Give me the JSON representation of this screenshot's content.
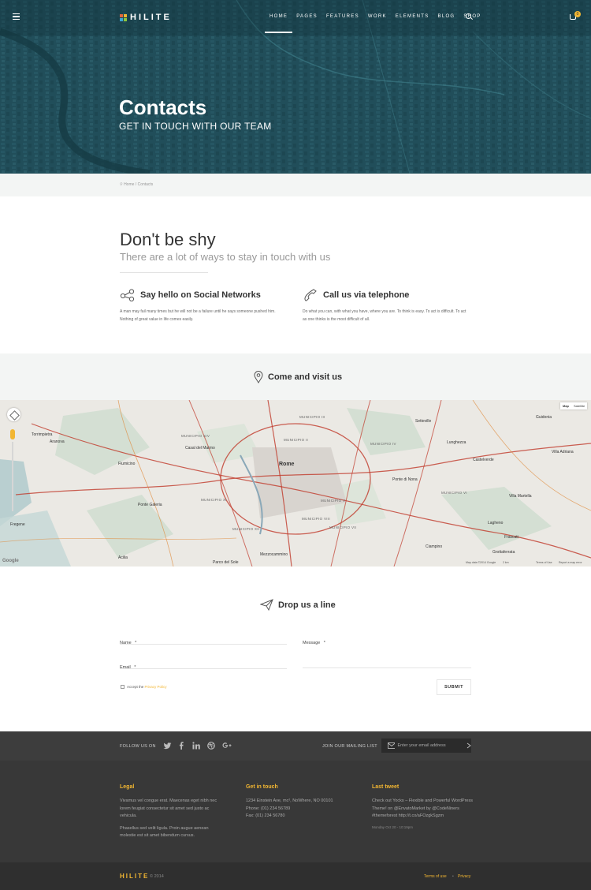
{
  "nav": {
    "logo": "HILITE",
    "items": [
      {
        "label": "Home"
      },
      {
        "label": "Pages"
      },
      {
        "label": "Features"
      },
      {
        "label": "Work"
      },
      {
        "label": "Elements"
      },
      {
        "label": "Blog"
      },
      {
        "label": "Shop"
      }
    ],
    "cart_count": "0"
  },
  "hero": {
    "title": "Contacts",
    "subtitle": "GET IN TOUCH WITH OUR TEAM"
  },
  "breadcrumb": {
    "home": "Home",
    "separator": "/",
    "current": "Contacts"
  },
  "intro": {
    "title": "Don't be shy",
    "subtitle": "There are a lot of ways to stay in touch with us"
  },
  "features": [
    {
      "icon": "share-icon",
      "title": "Say hello on Social Networks",
      "text": "A man may fail many times but he will not be a failure until he says someone pushed him. Nothing of great value in life comes easily."
    },
    {
      "icon": "phone-icon",
      "title": "Call us via telephone",
      "text": "Do what you can, with what you have, where you are. To think is easy. To act is difficult. To act as one thinks is the most difficult of all."
    }
  ],
  "visit": {
    "title": "Come and visit us"
  },
  "map": {
    "type_buttons": [
      "Map",
      "Satellite"
    ],
    "labels": {
      "city": "Rome",
      "areas": [
        "MUNICIPIO XIV",
        "MUNICIPIO II",
        "MUNICIPIO III",
        "MUNICIPIO IV",
        "MUNICIPIO V",
        "MUNICIPIO VII",
        "MUNICIPIO VIII",
        "MUNICIPIO XII",
        "MUNICIPIO XI",
        "MUNICIPIO VI"
      ],
      "places": [
        "Fiumicino",
        "Torrimpietra",
        "Aranova",
        "Casal del Marmo",
        "Ponte Galeria",
        "Fregene",
        "Acilia",
        "Setteville",
        "Guidonia",
        "Villa Adriana",
        "Castelverde",
        "Lunghezza",
        "Ponte di Nona",
        "Villa Martella",
        "Frascati",
        "Lagheno",
        "Grottaferrata",
        "Ciampino",
        "Mezzocammino",
        "Parco del Sole"
      ]
    },
    "attribution": "Map data ©2014 Google",
    "scale": "2 km",
    "terms": "Terms of Use",
    "report": "Report a map error",
    "google": "Google"
  },
  "contact_form": {
    "title": "Drop us a line",
    "name_label": "Name",
    "email_label": "Email",
    "message_label": "Message",
    "required_mark": "*",
    "accept_text": "Accept the",
    "privacy_link": "Privacy Policy",
    "submit_label": "SUBMIT"
  },
  "footer_bar": {
    "follow_label": "FOLLOW US ON",
    "social": [
      "twitter-icon",
      "facebook-icon",
      "linkedin-icon",
      "dribbble-icon",
      "google-plus-icon"
    ],
    "join_label": "JOIN OUR MAILING LIST",
    "email_placeholder": "Enter your email address"
  },
  "footer": {
    "legal": {
      "title": "Legal",
      "p1": "Vivamus vel congue erat. Maecenas eget nibh nec lorem feugiat consectetur sit amet sed justo ac vehicula.",
      "p2": "Phasellus sed velit ligula. Proin augue aenean molestie est sit amet bibendum cursus."
    },
    "contact": {
      "title": "Get in touch",
      "address": "1234 Einstein Ave, mc², NoWhere, NO 00101",
      "phone": "Phone: (01) 234 56789",
      "fax": "Fax: (01) 234 56780"
    },
    "tweet": {
      "title": "Last tweet",
      "text": "Check out Yocks – Flexible and Powerful WordPress Theme! on @EnvatoMarket by @CodeNiners #themeforest http://t.co/aFOzgkSgzm",
      "date": "Monday Oct 20 - 10:19pm"
    }
  },
  "bottom": {
    "logo": "HILITE",
    "year": "© 2014",
    "terms": "Terms of use",
    "privacy": "Privacy"
  },
  "colors": {
    "accent": "#f2b632",
    "hero": "#24535f",
    "footer": "#383838"
  }
}
